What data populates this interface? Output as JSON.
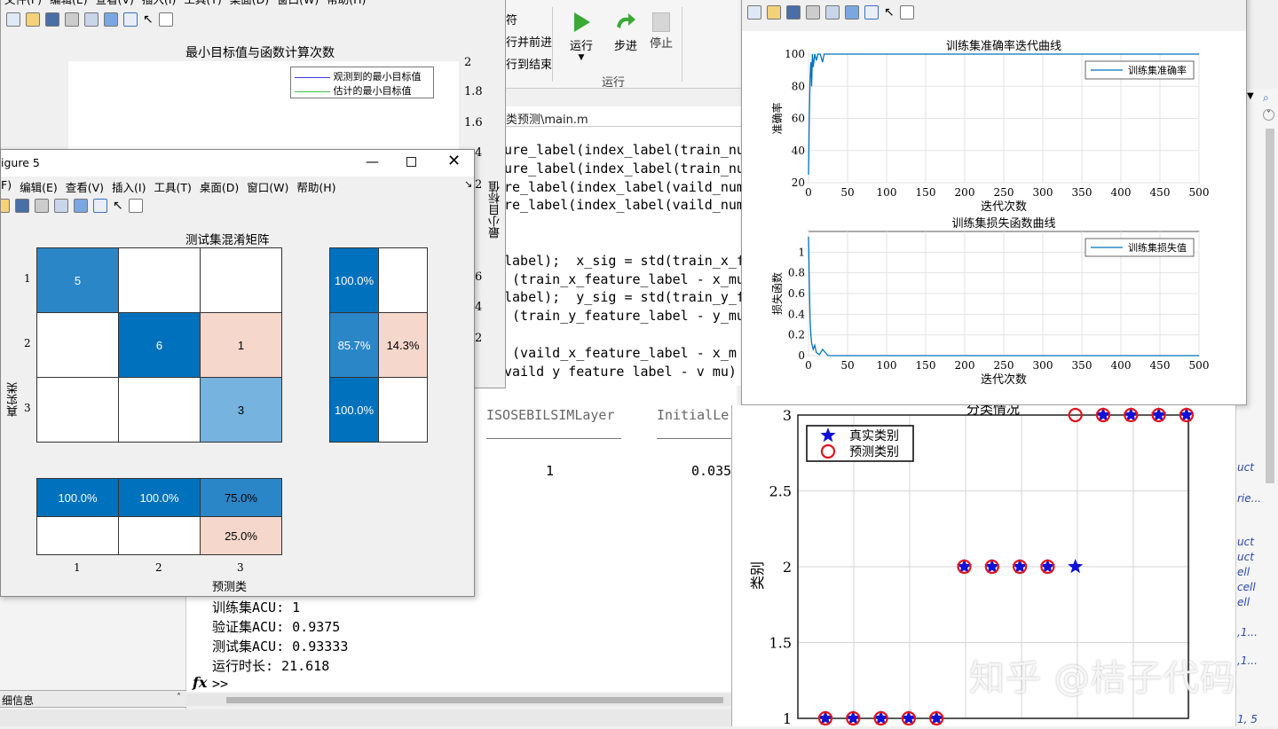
{
  "toolstrip": {
    "sec1_items": [
      "符",
      "行并前进",
      "行到结束"
    ],
    "run_label": "运行",
    "step_label": "步进",
    "stop_label": "停止",
    "section_label": "运行"
  },
  "editor": {
    "path": "类预测\\main.m",
    "lines": [
      "ure_label(index_label(train_nu",
      "ure_label(index_label(train_nu",
      "re_label(index_label(vaild_num",
      "re_label(index_label(vaild_num",
      "",
      "",
      "label);  x_sig = std(train_x_f",
      " (train_x_feature_label - x_mu",
      "label);  y_sig = std(train_y_f",
      " (train_y_feature_label - y_mu",
      "",
      " (vaild_x_feature_label - x_m",
      "vaild y feature label - v mu)"
    ]
  },
  "cmd": {
    "table_header1": "ISOSEBILSIMLayer",
    "table_header2": "InitialLe",
    "table_val1": "1",
    "table_val2": "0.035",
    "output": [
      "训练集ACU: 1",
      "验证集ACU: 0.9375",
      "测试集ACU: 0.93333",
      "运行时长: 21.618"
    ],
    "prompt": ">>",
    "fx": "fx"
  },
  "left_panel": {
    "detail_label": "细信息"
  },
  "fig_top_left": {
    "menu": [
      "文件(F)",
      "编辑(E)",
      "查看(V)",
      "插入(I)",
      "工具(T)",
      "桌面(D)",
      "窗口(W)",
      "帮助(H)"
    ],
    "title": "最小目标值与函数计算次数",
    "legend": [
      "观测到的最小目标值",
      "估计的最小目标值"
    ],
    "yticks": [
      "2",
      "1.8",
      "1.6",
      "4",
      "2",
      "6",
      "4",
      "2"
    ],
    "ylabel": "最小目标值"
  },
  "fig5": {
    "title": "igure 5",
    "menu": [
      "F)",
      "编辑(E)",
      "查看(V)",
      "插入(I)",
      "工具(T)",
      "桌面(D)",
      "窗口(W)",
      "帮助(H)"
    ],
    "chart_title": "测试集混淆矩阵",
    "ylabel": "真实类",
    "xlabel": "预测类",
    "row_labels": [
      "1",
      "2",
      "3"
    ],
    "col_labels": [
      "1",
      "2",
      "3"
    ],
    "matrix": [
      [
        "5",
        "",
        ""
      ],
      [
        "",
        "6",
        "1"
      ],
      [
        "",
        "",
        "3"
      ]
    ],
    "row_summary": [
      [
        "100.0%",
        ""
      ],
      [
        "85.7%",
        "14.3%"
      ],
      [
        "100.0%",
        ""
      ]
    ],
    "col_summary": [
      [
        "100.0%",
        "100.0%",
        "75.0%"
      ],
      [
        "",
        "",
        "25.0%"
      ]
    ],
    "colors": {
      "dark": "#0072bd",
      "mid": "#2b86c8",
      "light": "#76b3df",
      "pink": "#f6d7cb"
    }
  },
  "fig_train": {
    "acc_title": "训练集准确率迭代曲线",
    "acc_legend": "训练集准确率",
    "acc_ylabel": "准确率",
    "acc_xlabel": "迭代次数",
    "loss_title": "训练集损失函数曲线",
    "loss_legend": "训练集损失值",
    "loss_ylabel": "损失函数",
    "loss_xlabel": "迭代次数"
  },
  "fig_class": {
    "title": "分类情况",
    "legend": [
      "真实类别",
      "预测类别"
    ],
    "ylabel": "类别"
  },
  "watermark": "知乎 @桔子代码",
  "right_edge_text": [
    "uct",
    "rie...",
    "uct",
    "uct",
    "ell",
    "cell",
    "ell",
    ",1...",
    ",1...",
    "1, 5"
  ],
  "chart_data": [
    {
      "type": "line",
      "title": "训练集准确率迭代曲线",
      "xlabel": "迭代次数",
      "ylabel": "准确率",
      "xlim": [
        0,
        500
      ],
      "ylim": [
        20,
        100
      ],
      "xticks": [
        0,
        50,
        100,
        150,
        200,
        250,
        300,
        350,
        400,
        450,
        500
      ],
      "yticks": [
        20,
        40,
        60,
        80,
        100
      ],
      "grid": true,
      "legend_position": "top-right",
      "series": [
        {
          "name": "训练集准确率",
          "x": [
            0,
            1,
            2,
            3,
            4,
            5,
            6,
            8,
            10,
            12,
            15,
            18,
            20,
            25,
            500
          ],
          "y": [
            25,
            60,
            85,
            95,
            80,
            100,
            92,
            100,
            96,
            100,
            100,
            95,
            100,
            100,
            100
          ]
        }
      ]
    },
    {
      "type": "line",
      "title": "训练集损失函数曲线",
      "xlabel": "迭代次数",
      "ylabel": "损失函数",
      "xlim": [
        0,
        500
      ],
      "ylim": [
        0,
        1.2
      ],
      "xticks": [
        0,
        50,
        100,
        150,
        200,
        250,
        300,
        350,
        400,
        450,
        500
      ],
      "yticks": [
        0,
        0.2,
        0.4,
        0.6,
        0.8,
        1
      ],
      "grid": true,
      "legend_position": "top-right",
      "series": [
        {
          "name": "训练集损失值",
          "x": [
            0,
            1,
            2,
            3,
            4,
            6,
            8,
            10,
            14,
            18,
            25,
            500
          ],
          "y": [
            1.15,
            0.7,
            0.35,
            0.2,
            0.12,
            0.06,
            0.1,
            0.03,
            0.01,
            0.06,
            0.0,
            0.0
          ]
        }
      ]
    },
    {
      "type": "scatter",
      "title": "分类情况",
      "ylabel": "类别",
      "ylim": [
        1,
        3
      ],
      "yticks": [
        1,
        1.5,
        2,
        2.5,
        3
      ],
      "grid": true,
      "legend_position": "top-left",
      "series": [
        {
          "name": "真实类别",
          "x": [
            1,
            2,
            3,
            4,
            5,
            6,
            7,
            8,
            9,
            10,
            11,
            12,
            13,
            14
          ],
          "y": [
            1,
            1,
            1,
            1,
            1,
            2,
            2,
            2,
            2,
            2,
            3,
            3,
            3,
            3
          ]
        },
        {
          "name": "预测类别",
          "x": [
            1,
            2,
            3,
            4,
            5,
            6,
            7,
            8,
            9,
            10,
            11,
            12,
            13,
            14
          ],
          "y": [
            1,
            1,
            1,
            1,
            1,
            2,
            2,
            2,
            2,
            3,
            3,
            3,
            3,
            3
          ]
        }
      ]
    },
    {
      "type": "heatmap",
      "title": "测试集混淆矩阵",
      "xlabel": "预测类",
      "ylabel": "真实类",
      "categories": [
        "1",
        "2",
        "3"
      ],
      "values": [
        [
          5,
          0,
          0
        ],
        [
          0,
          6,
          1
        ],
        [
          0,
          0,
          3
        ]
      ]
    }
  ]
}
